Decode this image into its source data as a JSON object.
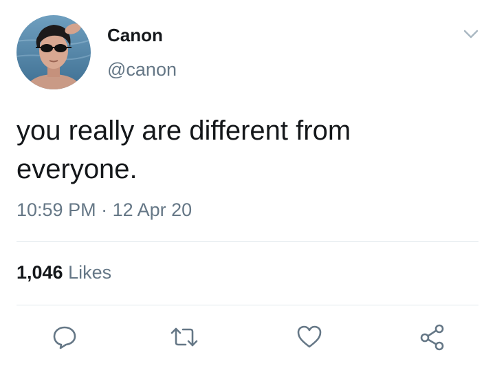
{
  "user": {
    "display_name": "Canon",
    "handle": "@canon"
  },
  "tweet": {
    "text": "you really are different from everyone.",
    "time": "10:59 PM",
    "separator": "·",
    "date": "12 Apr 20"
  },
  "stats": {
    "likes_count": "1,046",
    "likes_label": "Likes"
  },
  "actions": {
    "reply_icon": "speech-bubble",
    "retweet_icon": "retweet-arrows",
    "like_icon": "heart-outline",
    "share_icon": "share-nodes"
  },
  "colors": {
    "text": "#14171a",
    "secondary": "#657786",
    "icon": "#657786",
    "divider": "#e1e8ed"
  }
}
